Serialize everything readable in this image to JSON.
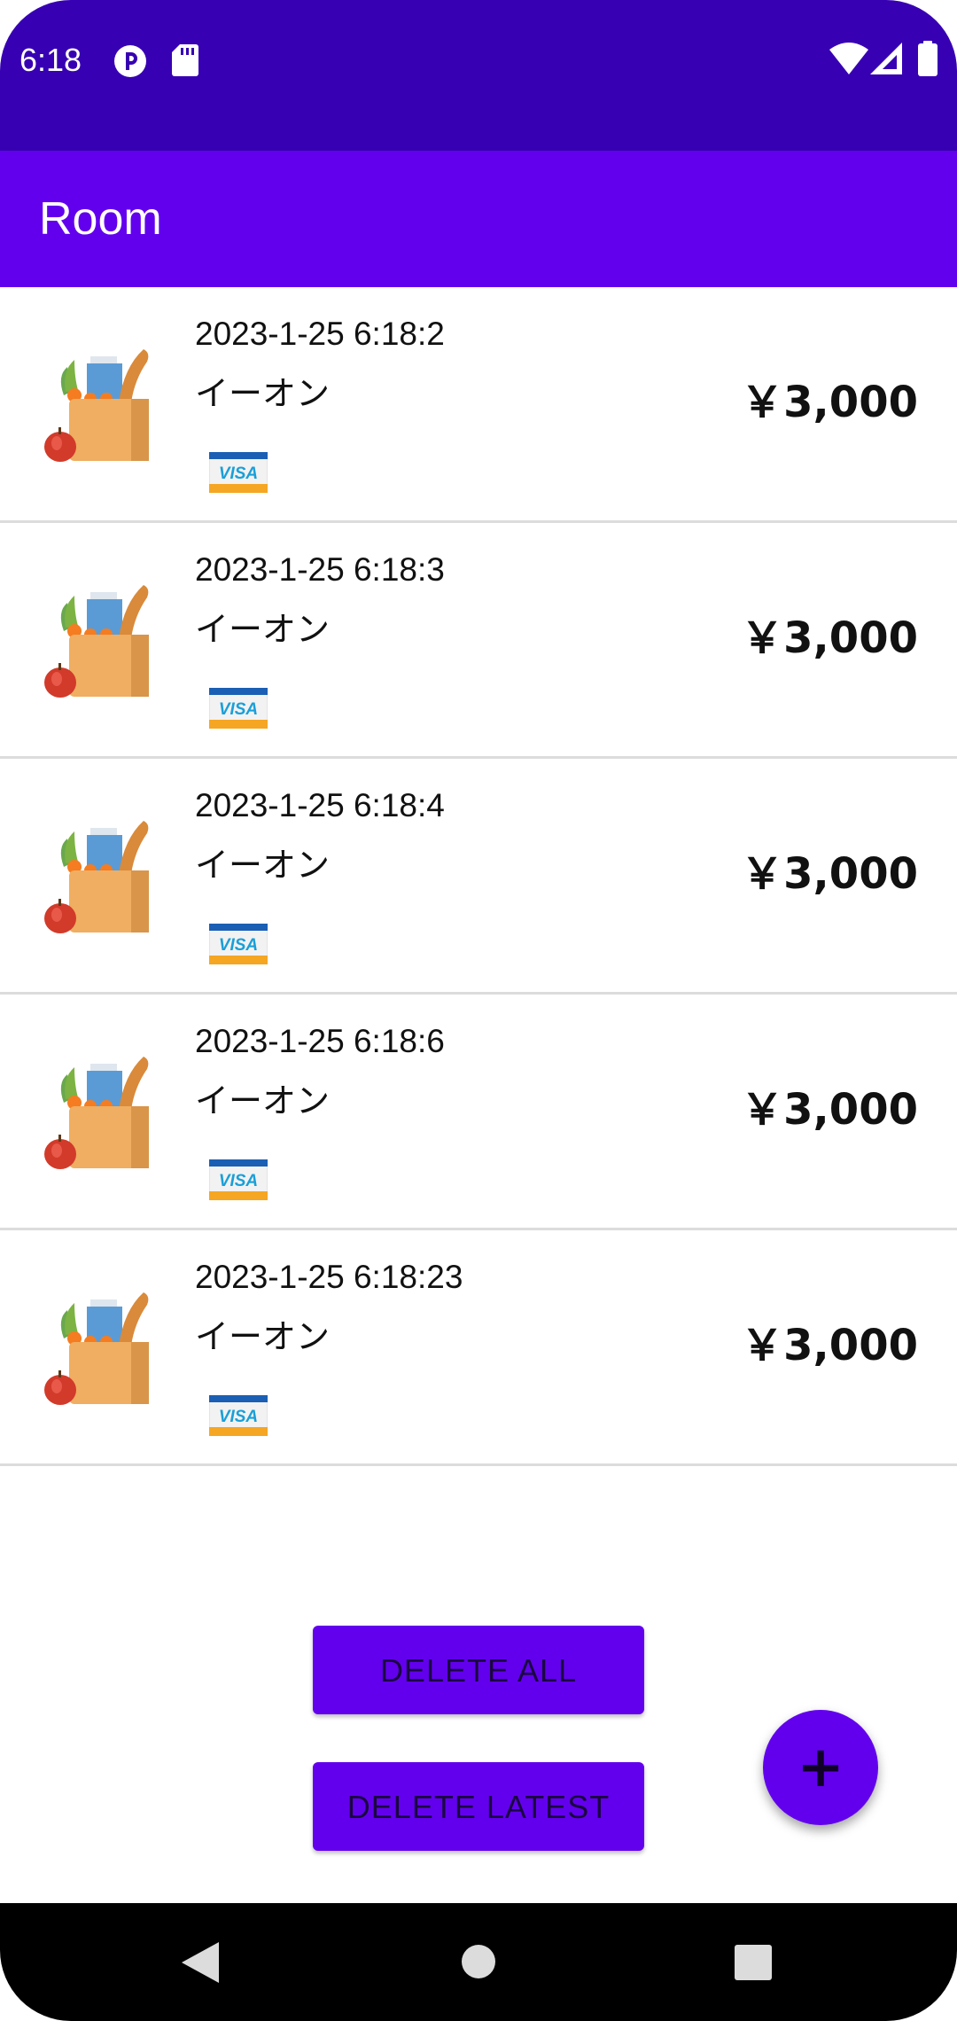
{
  "status_bar": {
    "time": "6:18",
    "left_icons": [
      "app-notification-icon",
      "sd-card-icon"
    ],
    "right_icons": [
      "wifi-icon",
      "cellular-signal-icon",
      "battery-icon"
    ]
  },
  "app_bar": {
    "title": "Room"
  },
  "transactions": [
    {
      "date": "2023-1-25 6:18:2",
      "store": "イーオン",
      "amount": "￥3,000",
      "card": "VISA"
    },
    {
      "date": "2023-1-25 6:18:3",
      "store": "イーオン",
      "amount": "￥3,000",
      "card": "VISA"
    },
    {
      "date": "2023-1-25 6:18:4",
      "store": "イーオン",
      "amount": "￥3,000",
      "card": "VISA"
    },
    {
      "date": "2023-1-25 6:18:6",
      "store": "イーオン",
      "amount": "￥3,000",
      "card": "VISA"
    },
    {
      "date": "2023-1-25 6:18:23",
      "store": "イーオン",
      "amount": "￥3,000",
      "card": "VISA"
    }
  ],
  "buttons": {
    "delete_all": "DELETE ALL",
    "delete_latest": "DELETE LATEST",
    "fab": "+"
  },
  "nav_bar": {
    "icons": [
      "back-icon",
      "home-icon",
      "recents-icon"
    ]
  },
  "colors": {
    "status_bar": "#3700b3",
    "primary": "#6200ee",
    "divider": "#dcdcdc"
  }
}
